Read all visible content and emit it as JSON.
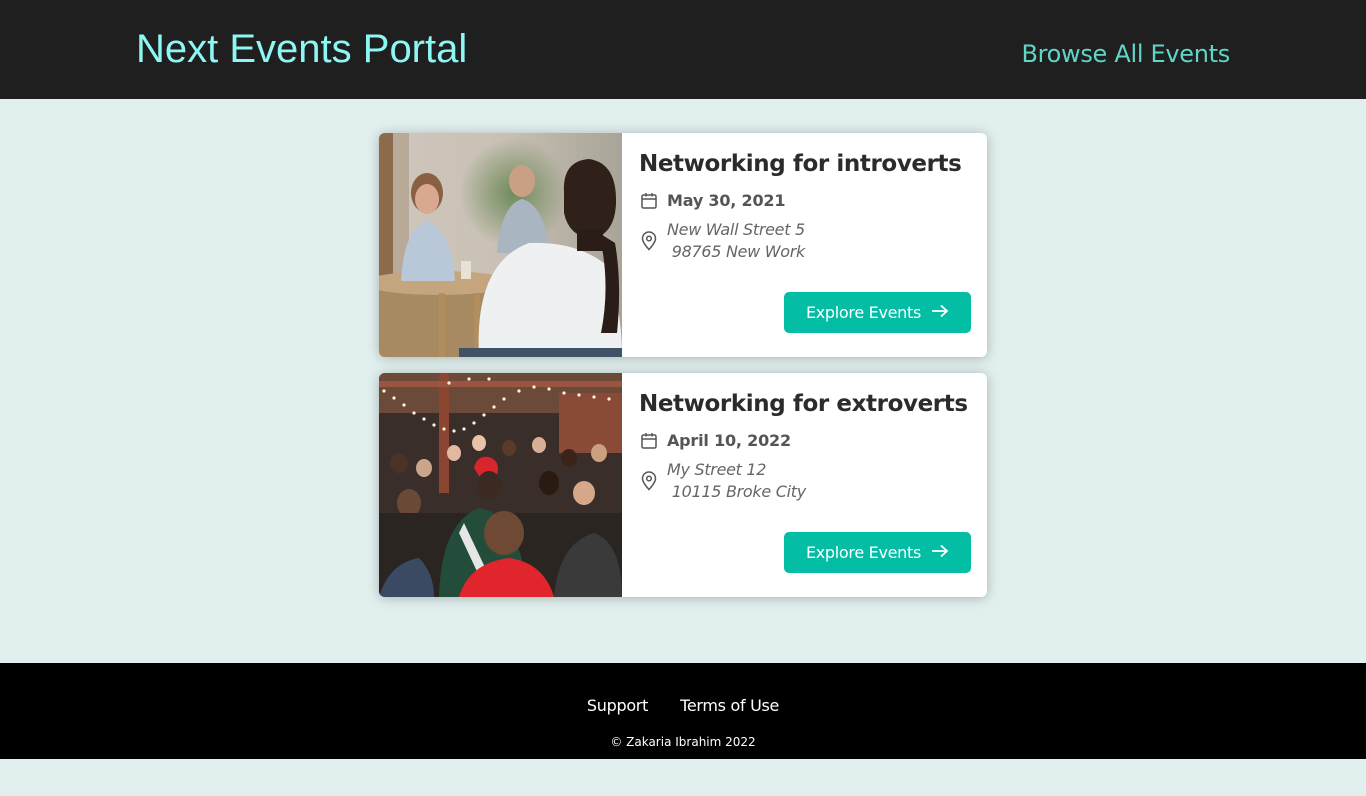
{
  "header": {
    "logo": "Next Events Portal",
    "nav_link": "Browse All Events",
    "logo_color": "#8df7f4",
    "link_color": "#5fd6c8"
  },
  "events": [
    {
      "title": "Networking for introverts",
      "date": "May 30, 2021",
      "address": "New Wall Street 5\n 98765 New Work",
      "button_label": "Explore Events",
      "image": "photo-man-sitting-cafe"
    },
    {
      "title": "Networking for extroverts",
      "date": "April 10, 2022",
      "address": "My Street 12\n 10115 Broke City",
      "button_label": "Explore Events",
      "image": "photo-crowd-string-lights"
    }
  ],
  "footer": {
    "links": [
      "Support",
      "Terms of Use"
    ],
    "copyright": "© Zakaria Ibrahim 2022"
  },
  "colors": {
    "page_bg": "#e1efee",
    "header_bg": "#1f1f1f",
    "button_bg": "#03bea5",
    "footer_bg": "#000000"
  },
  "icons": {
    "date": "calendar-icon",
    "address": "location-pin-icon",
    "button": "arrow-right-icon"
  }
}
